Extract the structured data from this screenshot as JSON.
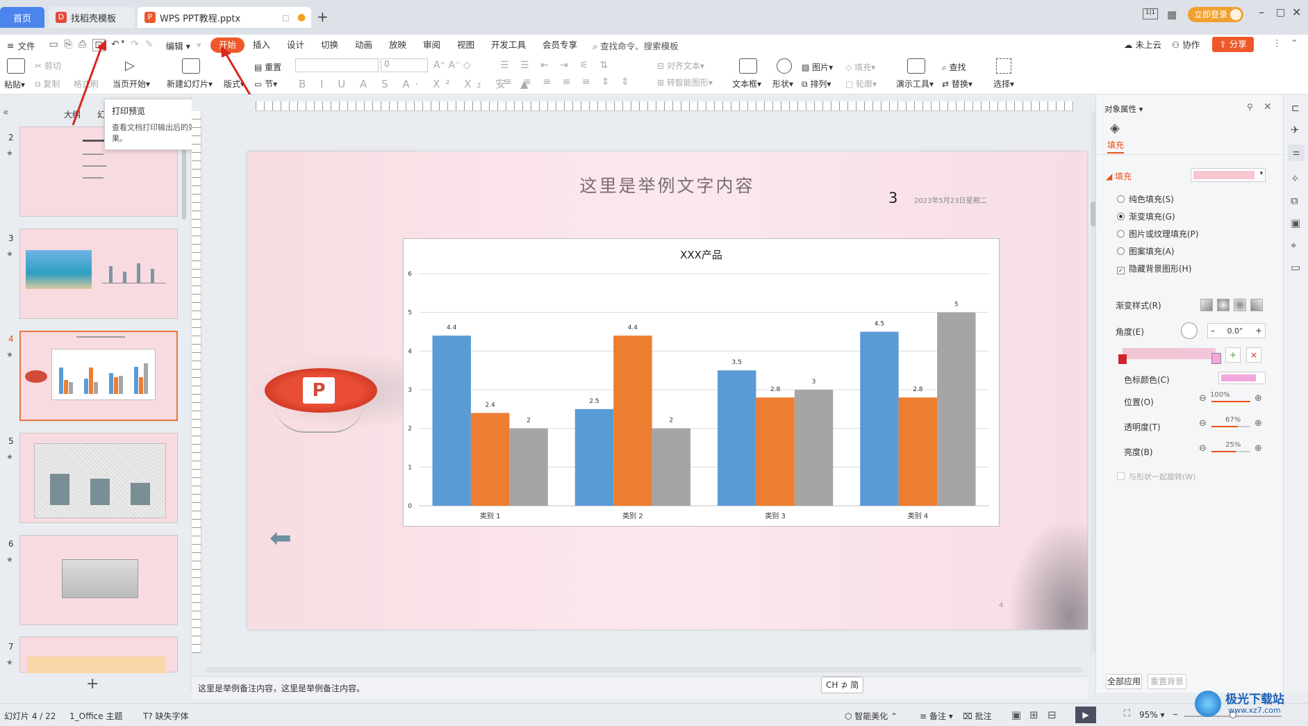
{
  "titlebar": {
    "tab_home": "首页",
    "tab_template": "找稻壳模板",
    "tab_doc": "WPS PPT教程.pptx",
    "login_button": "立即登录",
    "brand_colors": {
      "wps_red": "#e64a3a",
      "accent_orange": "#f0582b",
      "home_blue": "#4c84ee"
    }
  },
  "menubar": {
    "file": "文件",
    "edit": "编辑",
    "items": [
      "开始",
      "插入",
      "设计",
      "切换",
      "动画",
      "放映",
      "审阅",
      "视图",
      "开发工具",
      "会员专享"
    ],
    "search": "查找命令、搜索模板",
    "cloud": "未上云",
    "collab": "协作",
    "share": "分享"
  },
  "ribbon": {
    "paste": "粘贴",
    "cut": "剪切",
    "copy": "复制",
    "format_painter": "格式刷",
    "from_current": "当页开始",
    "new_slide": "新建幻灯片",
    "layout": "版式",
    "reset": "重置",
    "section": "节",
    "font_size": "0",
    "align_text": "对齐文本",
    "smart_art": "转智能图形",
    "text_box": "文本框",
    "shape": "形状",
    "picture": "图片",
    "arrange": "排列",
    "fill": "填充",
    "outline": "轮廓",
    "presenter_tools": "演示工具",
    "find": "查找",
    "replace": "替换",
    "select": "选择"
  },
  "tooltip": {
    "title": "打印预览",
    "body": "查看文档打印输出后的效果。"
  },
  "leftpanel": {
    "tab_outline": "大纲",
    "tab_slides": "幻",
    "thumbs": [
      {
        "num": "2",
        "star": "★"
      },
      {
        "num": "3",
        "star": "★"
      },
      {
        "num": "4",
        "star": "★"
      },
      {
        "num": "5",
        "star": "★"
      },
      {
        "num": "6",
        "star": "★"
      },
      {
        "num": "7",
        "star": "★"
      }
    ],
    "add": "+"
  },
  "slide": {
    "title": "这里是举例文字内容",
    "number": "3",
    "date": "2023年5月23日星期二",
    "page_num": "4"
  },
  "chart_data": {
    "type": "bar",
    "title": "XXX产品",
    "categories": [
      "类别 1",
      "类别 2",
      "类别 3",
      "类别 4"
    ],
    "series": [
      {
        "values": [
          4.4,
          2.5,
          3.5,
          4.5
        ],
        "color": "#5b9bd5"
      },
      {
        "values": [
          2.4,
          4.4,
          2.8,
          2.8
        ],
        "color": "#ed7d31"
      },
      {
        "values": [
          2,
          2,
          3,
          5
        ],
        "color": "#a5a5a5"
      }
    ],
    "yticks": [
      "0",
      "1",
      "2",
      "3",
      "4",
      "5",
      "6"
    ],
    "ylim": [
      0,
      6
    ],
    "grid": true
  },
  "notes": {
    "text": "这里是举例备注内容，这里是举例备注内容。",
    "ime": "CH ⊅ 简"
  },
  "rightpanel": {
    "header": "对象属性",
    "tab_fill": "填充",
    "section_fill": "填充",
    "options": [
      {
        "label": "纯色填充(S)",
        "checked": false
      },
      {
        "label": "渐变填充(G)",
        "checked": true
      },
      {
        "label": "图片或纹理填充(P)",
        "checked": false
      },
      {
        "label": "图案填充(A)",
        "checked": false
      }
    ],
    "hide_bg": "隐藏背景图形(H)",
    "gradient_style": "渐变样式(R)",
    "angle": "角度(E)",
    "angle_value": "0.0°",
    "stop_color": "色标颜色(C)",
    "position": "位置(O)",
    "position_value": "100%",
    "transparency": "透明度(T)",
    "transparency_value": "67%",
    "brightness": "亮度(B)",
    "brightness_value": "25%",
    "rotate_with": "与形状一起旋转(W)",
    "apply_all": "全部应用",
    "reset_bg": "重置背景",
    "fill_color": "#f7c6d0",
    "stop_swatch": "#f2a8dc"
  },
  "statusbar": {
    "slide_info": "幻灯片 4 / 22",
    "theme": "1_Office 主题",
    "missing_font": "缺失字体",
    "beautify": "智能美化",
    "notes": "备注",
    "comments": "批注",
    "zoom": "95%"
  },
  "watermark": {
    "site": "极光下载站",
    "url": "www.xz7.com"
  }
}
